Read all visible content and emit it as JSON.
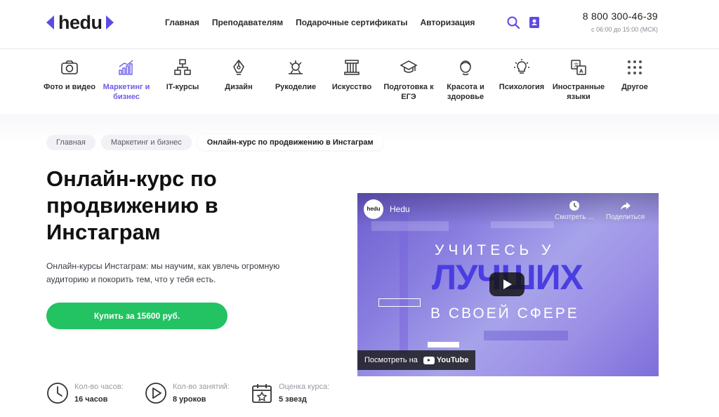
{
  "header": {
    "logo_text": "hedu",
    "nav": [
      "Главная",
      "Преподавателям",
      "Подарочные сертификаты",
      "Авторизация"
    ],
    "phone": "8 800 300-46-39",
    "hours": "с 06:00 до 15:00 (МСК)",
    "accent": "#5c4ae4"
  },
  "categories": [
    {
      "label": "Фото и видео",
      "icon": "camera-icon"
    },
    {
      "label": "Маркетинг и бизнес",
      "icon": "chart-icon",
      "active": true
    },
    {
      "label": "IT-курсы",
      "icon": "network-icon"
    },
    {
      "label": "Дизайн",
      "icon": "pen-tool-icon"
    },
    {
      "label": "Рукоделие",
      "icon": "craft-icon"
    },
    {
      "label": "Искусство",
      "icon": "column-icon"
    },
    {
      "label": "Подготовка к ЕГЭ",
      "icon": "graduation-cap-icon"
    },
    {
      "label": "Красота и здоровье",
      "icon": "face-icon"
    },
    {
      "label": "Психология",
      "icon": "lightbulb-icon"
    },
    {
      "label": "Иностранные языки",
      "icon": "translate-icon"
    },
    {
      "label": "Другое",
      "icon": "grid-dots-icon"
    }
  ],
  "breadcrumbs": [
    "Главная",
    "Маркетинг и бизнес",
    "Онлайн-курс по продвижению в Инстаграм"
  ],
  "course": {
    "title": "Онлайн-курс по продвижению в Инстаграм",
    "description": "Онлайн-курсы Инстаграм: мы научим, как увлечь огромную аудиторию и покорить тем, что у тебя есть.",
    "buy_label": "Купить за 15600 руб.",
    "button_color": "#23c262"
  },
  "stats": [
    {
      "label": "Кол-во часов:",
      "value": "16 часов",
      "icon": "clock-icon"
    },
    {
      "label": "Кол-во занятий:",
      "value": "8 уроков",
      "icon": "play-circle-icon"
    },
    {
      "label": "Оценка курса:",
      "value": "5 звезд",
      "icon": "calendar-star-icon"
    }
  ],
  "video": {
    "channel_logo": "hedu",
    "channel": "Hedu",
    "watch_later": "Смотреть ...",
    "share": "Поделиться",
    "line1": "УЧИТЕСЬ У",
    "line2": "ЛУЧШИХ",
    "line3": "В СВОЕЙ СФЕРЕ",
    "watch_on": "Посмотреть на",
    "youtube": "YouTube"
  }
}
